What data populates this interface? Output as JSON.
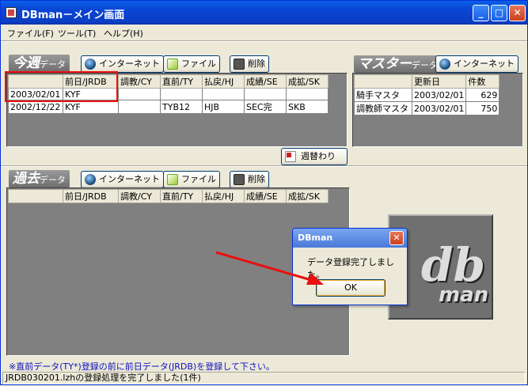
{
  "window": {
    "title": "DBman－メイン画面",
    "controls": {
      "minimize": "_",
      "maximize": "□",
      "close": "✕"
    }
  },
  "menu": [
    {
      "label": "ファイル(F)"
    },
    {
      "label": "ツール(T)"
    },
    {
      "label": "ヘルプ(H)"
    }
  ],
  "this_week": {
    "label_main": "今週",
    "label_sub": "データ",
    "buttons": {
      "internet": "インターネット",
      "file": "ファイル",
      "delete": "削除"
    },
    "columns": [
      "",
      "前日/JRDB",
      "調教/CY",
      "直前/TY",
      "払戻/HJ",
      "成績/SE",
      "成拡/SK"
    ],
    "rows": [
      [
        "2003/02/01",
        "KYF",
        "",
        "",
        "",
        "",
        ""
      ],
      [
        "2002/12/22",
        "KYF",
        "",
        "TYB12",
        "HJB",
        "SEC完",
        "SKB"
      ]
    ],
    "week_change_button": "週替わり"
  },
  "master": {
    "label_main": "マスター",
    "label_sub": "データ",
    "buttons": {
      "internet": "インターネット"
    },
    "columns": [
      "",
      "更新日",
      "件数"
    ],
    "rows": [
      [
        "騎手マスタ",
        "2003/02/01",
        "629"
      ],
      [
        "調教師マスタ",
        "2003/02/01",
        "750"
      ]
    ]
  },
  "past": {
    "label_main": "過去",
    "label_sub": "データ",
    "buttons": {
      "internet": "インターネット",
      "file": "ファイル",
      "delete": "削除"
    },
    "columns": [
      "",
      "前日/JRDB",
      "調教/CY",
      "直前/TY",
      "払戻/HJ",
      "成績/SE",
      "成拡/SK"
    ]
  },
  "dialog": {
    "title": "DBman",
    "message": "データ登録完了しました。",
    "ok": "OK",
    "close": "✕"
  },
  "logo": {
    "text_top": "db",
    "text_bottom": "man"
  },
  "note": "※直前データ(TY*)登録の前に前日データ(JRDB)を登録して下さい。",
  "status": "JRDB030201.lzhの登録処理を完了しました(1件)",
  "colors": {
    "highlight": "#ee1010",
    "arrow": "#e81010",
    "note_text": "#1010c0"
  }
}
